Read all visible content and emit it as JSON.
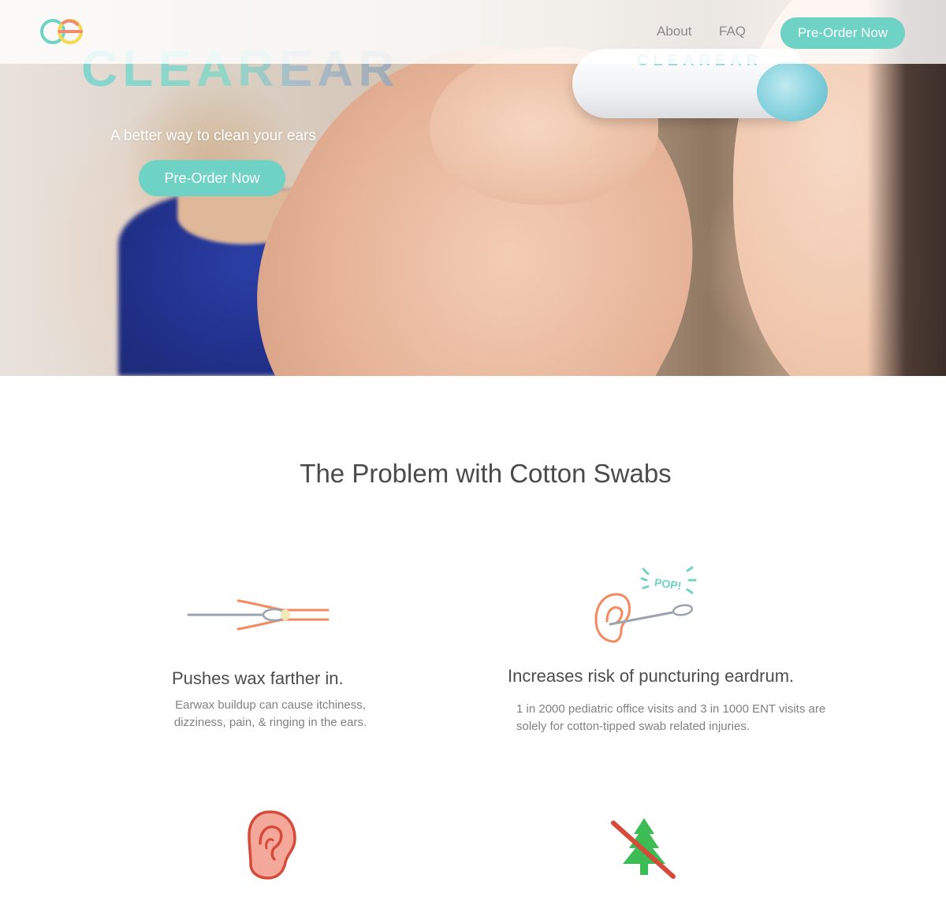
{
  "nav": {
    "links": [
      {
        "label": "About"
      },
      {
        "label": "FAQ"
      }
    ],
    "cta_label": "Pre-Order Now"
  },
  "hero": {
    "brand": "CLEAREAR",
    "device_label": "CLEAREAR",
    "tagline": "A better way to clean your ears",
    "cta_label": "Pre-Order Now"
  },
  "problem": {
    "title": "The Problem with Cotton Swabs",
    "features": [
      {
        "title": "Pushes wax farther in.",
        "description": "Earwax buildup can cause itchiness, dizziness, pain, & ringing in the ears.",
        "icon": "swab-in-ear-canal-icon"
      },
      {
        "title": "Increases risk of puncturing eardrum.",
        "description": "1 in 2000 pediatric office visits and 3 in 1000 ENT visits are solely for cotton-tipped swab related injuries.",
        "icon": "ear-swab-pop-icon",
        "pop_text": "POP!"
      },
      {
        "icon": "red-ear-icon"
      },
      {
        "icon": "no-tree-icon"
      }
    ]
  },
  "colors": {
    "accent": "#6ed2c4",
    "logo_teal": "#6ed2c4",
    "logo_yellow": "#f5d84b",
    "logo_orange": "#f48a6e",
    "icon_orange": "#f4885f",
    "icon_gray": "#9aa4b0",
    "icon_red": "#d64a3a",
    "icon_green": "#3dbb55"
  }
}
